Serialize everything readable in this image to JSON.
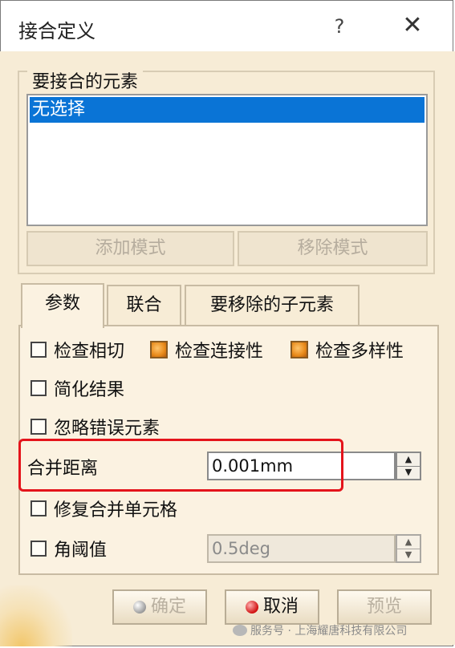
{
  "window": {
    "title": "接合定义",
    "help_label": "?",
    "close_label": "✕"
  },
  "elements_group": {
    "label": "要接合的元素",
    "items": [
      "无选择"
    ],
    "add_mode_label": "添加模式",
    "remove_mode_label": "移除模式"
  },
  "tabs": [
    {
      "label": "参数",
      "active": true
    },
    {
      "label": "联合",
      "active": false
    },
    {
      "label": "要移除的子元素",
      "active": false
    }
  ],
  "params": {
    "check_tangency": {
      "label": "检查相切",
      "checked": false
    },
    "check_connectivity": {
      "label": "检查连接性",
      "checked": true
    },
    "check_manifold": {
      "label": "检查多样性",
      "checked": true
    },
    "simplify_result": {
      "label": "简化结果",
      "checked": false
    },
    "ignore_errors": {
      "label": "忽略错误元素",
      "checked": false
    },
    "merge_distance": {
      "label": "合并距离",
      "value": "0.001mm"
    },
    "heal_merged_cells": {
      "label": "修复合并单元格",
      "checked": false
    },
    "angular_threshold": {
      "label": "角阈值",
      "value": "0.5deg",
      "enabled": false
    }
  },
  "buttons": {
    "ok_label": "确定",
    "cancel_label": "取消",
    "preview_label": "预览"
  },
  "watermark": "服务号 · 上海耀唐科技有限公司",
  "colors": {
    "selection": "#0a74d6",
    "highlight_box": "#e4141b",
    "panel_bg": "#f7ecd6"
  }
}
